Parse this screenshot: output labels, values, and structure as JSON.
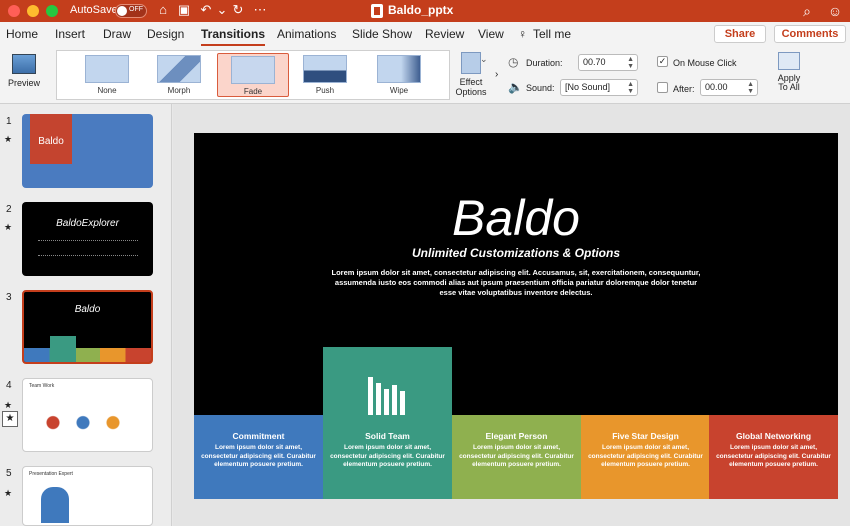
{
  "titlebar": {
    "autosave_label": "AutoSave",
    "autosave_state": "OFF",
    "doc_title": "Baldo_pptx",
    "colors": {
      "accent": "#c43e1c"
    }
  },
  "tabs": [
    "Home",
    "Insert",
    "Draw",
    "Design",
    "Transitions",
    "Animations",
    "Slide Show",
    "Review",
    "View"
  ],
  "tell_me": "Tell me",
  "share_label": "Share",
  "comments_label": "Comments",
  "ribbon": {
    "preview_label": "Preview",
    "transitions": [
      "None",
      "Morph",
      "Fade",
      "Push",
      "Wipe"
    ],
    "selected_transition": "Fade",
    "effect_options_line1": "Effect",
    "effect_options_line2": "Options",
    "duration_label": "Duration:",
    "duration_value": "00.70",
    "sound_label": "Sound:",
    "sound_value": "[No Sound]",
    "on_mouse_click_label": "On Mouse Click",
    "after_label": "After:",
    "after_value": "00.00",
    "apply_line1": "Apply",
    "apply_line2": "To All"
  },
  "thumbnails": [
    {
      "number": "1",
      "logo": "Baldo"
    },
    {
      "number": "2",
      "title": "BaldoExplorer"
    },
    {
      "number": "3",
      "title": "Baldo"
    },
    {
      "number": "4",
      "title": "Team Work"
    },
    {
      "number": "5",
      "title": "Presentation Expert"
    }
  ],
  "slide": {
    "title": "Baldo",
    "subtitle": "Unlimited Customizations & Options",
    "body": "Lorem ipsum dolor sit amet, consectetur adipiscing elit. Accusamus, sit, exercitationem, consequuntur, assumenda iusto eos commodi alias aut ipsum praesentium officia pariatur doloremque dolor tenetur esse vitae voluptatibus inventore delectus.",
    "cards": [
      {
        "title": "Commitment",
        "text": "Lorem ipsum dolor sit amet, consectetur adipiscing elit. Curabitur elementum posuere pretium.",
        "color": "#3f79bd"
      },
      {
        "title": "Solid Team",
        "text": "Lorem ipsum dolor sit amet, consectetur adipiscing elit. Curabitur elementum posuere pretium.",
        "color": "#3a9a82"
      },
      {
        "title": "Elegant Person",
        "text": "Lorem ipsum dolor sit amet, consectetur adipiscing elit. Curabitur elementum posuere pretium.",
        "color": "#8fb04f"
      },
      {
        "title": "Five Star Design",
        "text": "Lorem ipsum dolor sit amet, consectetur adipiscing elit. Curabitur elementum posuere pretium.",
        "color": "#e8962c"
      },
      {
        "title": "Global Networking",
        "text": "Lorem ipsum dolor sit amet, consectetur adipiscing elit. Curabitur elementum posuere pretium.",
        "color": "#c8432e"
      }
    ]
  }
}
